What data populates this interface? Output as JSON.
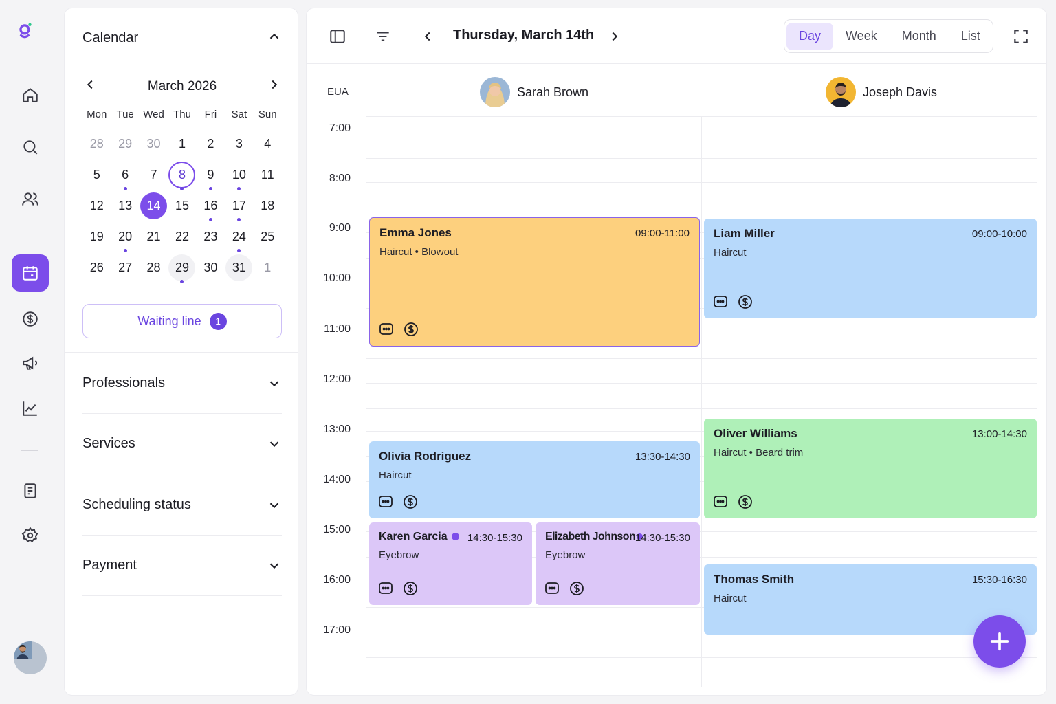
{
  "sidebar_panel": {
    "title": "Calendar",
    "month_label": "March 2026",
    "weekdays": [
      "Mon",
      "Tue",
      "Wed",
      "Thu",
      "Fri",
      "Sat",
      "Sun"
    ],
    "days": [
      {
        "n": "28",
        "muted": true
      },
      {
        "n": "29",
        "muted": true
      },
      {
        "n": "30",
        "muted": true
      },
      {
        "n": "1"
      },
      {
        "n": "2"
      },
      {
        "n": "3"
      },
      {
        "n": "4"
      },
      {
        "n": "5"
      },
      {
        "n": "6",
        "dot": true
      },
      {
        "n": "7"
      },
      {
        "n": "8",
        "today": true,
        "dot": true
      },
      {
        "n": "9",
        "dot": true
      },
      {
        "n": "10",
        "dot": true
      },
      {
        "n": "11"
      },
      {
        "n": "12"
      },
      {
        "n": "13"
      },
      {
        "n": "14",
        "selected": true
      },
      {
        "n": "15"
      },
      {
        "n": "16",
        "dot": true
      },
      {
        "n": "17",
        "dot": true
      },
      {
        "n": "18"
      },
      {
        "n": "19"
      },
      {
        "n": "20",
        "dot": true
      },
      {
        "n": "21"
      },
      {
        "n": "22"
      },
      {
        "n": "23"
      },
      {
        "n": "24",
        "dot": true
      },
      {
        "n": "25"
      },
      {
        "n": "26"
      },
      {
        "n": "27"
      },
      {
        "n": "28"
      },
      {
        "n": "29",
        "shade": true,
        "dot": true
      },
      {
        "n": "30"
      },
      {
        "n": "31",
        "shade": true
      },
      {
        "n": "1",
        "muted": true
      }
    ],
    "waiting_line_label": "Waiting line",
    "waiting_line_count": "1",
    "filters": [
      "Professionals",
      "Services",
      "Scheduling status",
      "Payment"
    ]
  },
  "toolbar": {
    "date_title": "Thursday, March 14th",
    "views": [
      "Day",
      "Week",
      "Month",
      "List"
    ],
    "active_view": "Day"
  },
  "schedule": {
    "timezone": "EUA",
    "hours": [
      "7:00",
      "8:00",
      "9:00",
      "10:00",
      "11:00",
      "12:00",
      "13:00",
      "14:00",
      "15:00",
      "16:00",
      "17:00"
    ],
    "professionals": [
      {
        "name": "Sarah Brown"
      },
      {
        "name": "Joseph Davis"
      }
    ],
    "events": [
      {
        "name": "Emma Jones",
        "time": "09:00-11:00",
        "services": "Haircut • Blowout",
        "color": "#fdd07e",
        "column": 0,
        "lane": "full"
      },
      {
        "name": "Liam Miller",
        "time": "09:00-10:00",
        "services": "Haircut",
        "color": "#b7d9fb",
        "column": 1,
        "lane": "full"
      },
      {
        "name": "Oliver Williams",
        "time": "13:00-14:30",
        "services": "Haircut • Beard trim",
        "color": "#aff0b8",
        "column": 1,
        "lane": "full"
      },
      {
        "name": "Olivia Rodriguez",
        "time": "13:30-14:30",
        "services": "Haircut",
        "color": "#b7d9fb",
        "column": 0,
        "lane": "full"
      },
      {
        "name": "Karen Garcia",
        "time": "14:30-15:30",
        "services": "Eyebrow",
        "color": "#dcc7f8",
        "column": 0,
        "lane": "left"
      },
      {
        "name": "Elizabeth Johnson",
        "time": "14:30-15:30",
        "services": "Eyebrow",
        "color": "#dcc7f8",
        "column": 0,
        "lane": "right"
      },
      {
        "name": "Thomas Smith",
        "time": "15:30-16:30",
        "services": "Haircut",
        "color": "#b7d9fb",
        "column": 1,
        "lane": "full"
      }
    ]
  },
  "colors": {
    "accent": "#7c4dea",
    "accent_light": "#ebe5fd"
  }
}
